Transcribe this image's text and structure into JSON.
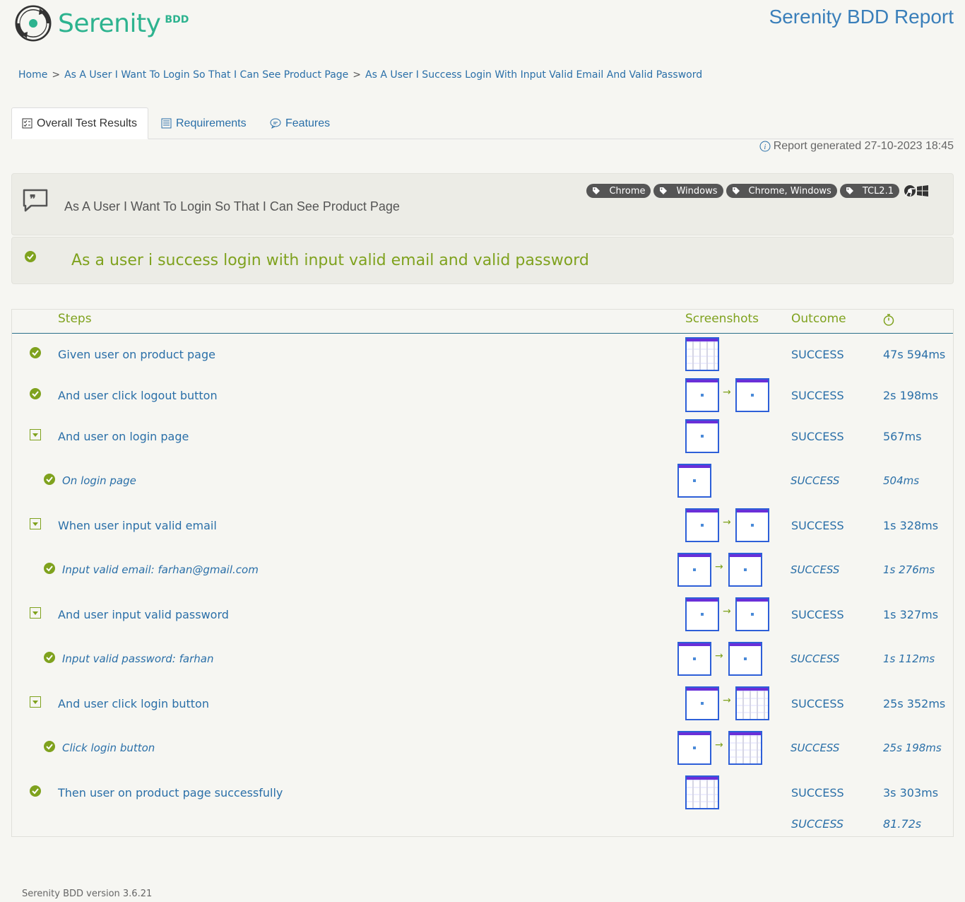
{
  "brand": {
    "logo_text": "Serenity",
    "logo_sub": "BDD",
    "report_title": "Serenity BDD Report"
  },
  "breadcrumb": {
    "home": "Home",
    "sep": ">",
    "feature": "As A User I Want To Login So That I Can See Product Page",
    "scenario": "As A User I Success Login With Input Valid Email And Valid Password"
  },
  "tabs": [
    {
      "label": "Overall Test Results",
      "icon": "checklist-icon",
      "active": true
    },
    {
      "label": "Requirements",
      "icon": "list-icon",
      "active": false
    },
    {
      "label": "Features",
      "icon": "comment-icon",
      "active": false
    }
  ],
  "generated": "Report generated 27-10-2023 18:45",
  "feature": {
    "title": "As A User I Want To Login So That I Can See Product Page",
    "tags": [
      "Chrome",
      "Windows",
      "Chrome, Windows",
      "TCL2.1"
    ]
  },
  "scenario": {
    "title": "As a user i success login with input valid email and valid password",
    "status_color": "#7fa21e"
  },
  "table": {
    "headers": {
      "steps": "Steps",
      "screenshots": "Screenshots",
      "outcome": "Outcome"
    },
    "rows": [
      {
        "desc": "Given user on product page",
        "outcome": "SUCCESS",
        "duration": "47s 594ms"
      },
      {
        "desc": "And user click logout button",
        "outcome": "SUCCESS",
        "duration": "2s 198ms"
      },
      {
        "desc": "And user on login page",
        "outcome": "SUCCESS",
        "duration": "567ms"
      },
      {
        "desc": "On login page",
        "outcome": "SUCCESS",
        "duration": "504ms"
      },
      {
        "desc": "When user input valid email",
        "outcome": "SUCCESS",
        "duration": "1s 328ms"
      },
      {
        "desc": "Input valid email: farhan@gmail.com",
        "outcome": "SUCCESS",
        "duration": "1s 276ms"
      },
      {
        "desc": "And user input valid password",
        "outcome": "SUCCESS",
        "duration": "1s 327ms"
      },
      {
        "desc": "Input valid password: farhan",
        "outcome": "SUCCESS",
        "duration": "1s 112ms"
      },
      {
        "desc": "And user click login button",
        "outcome": "SUCCESS",
        "duration": "25s 352ms"
      },
      {
        "desc": "Click login button",
        "outcome": "SUCCESS",
        "duration": "25s 198ms"
      },
      {
        "desc": "Then user on product page successfully",
        "outcome": "SUCCESS",
        "duration": "3s 303ms"
      }
    ],
    "total": {
      "outcome": "SUCCESS",
      "duration": "81.72s"
    }
  },
  "footer": "Serenity BDD version 3.6.21",
  "colors": {
    "success": "#7fa21e",
    "link": "#2a6fa8",
    "accent": "#2db38f"
  }
}
